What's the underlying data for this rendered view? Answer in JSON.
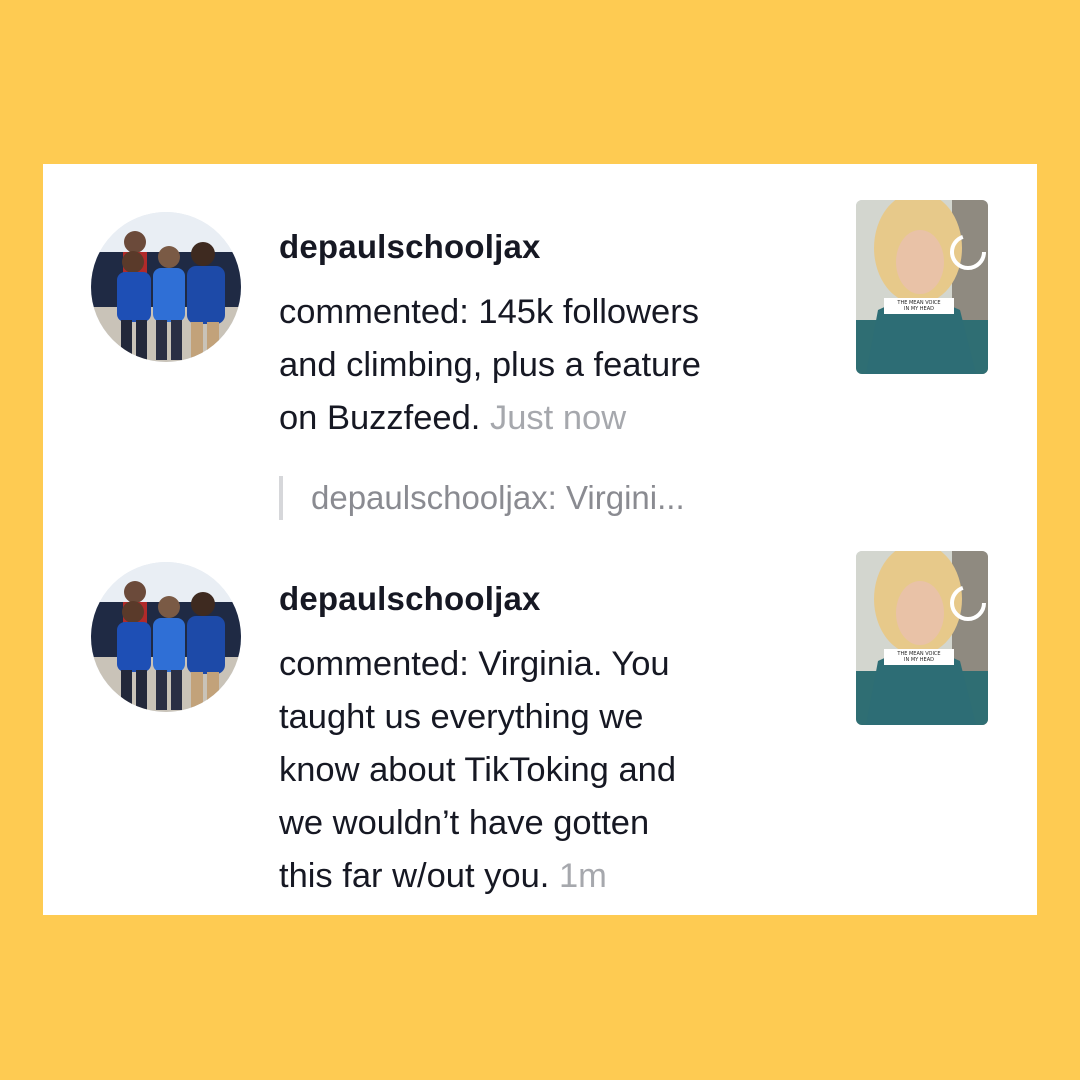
{
  "notifications": [
    {
      "username": "depaulschooljax",
      "avatar_icon": "group-photo-avatar",
      "comment_lines": [
        "commented: 145k followers",
        "and climbing, plus a feature",
        "on Buzzfeed."
      ],
      "time": "Just now",
      "reply_quote": "depaulschooljax: Virgini...",
      "thumbnail": {
        "icon": "video-thumbnail",
        "caption_line1": "THE MEAN VOICE",
        "caption_line2": "IN MY HEAD"
      }
    },
    {
      "username": "depaulschooljax",
      "avatar_icon": "group-photo-avatar",
      "comment_lines": [
        "commented: Virginia. You",
        "taught us everything we",
        "know about TikToking and",
        "we wouldn’t have gotten",
        "this far w/out you."
      ],
      "time": "1m",
      "thumbnail": {
        "icon": "video-thumbnail",
        "caption_line1": "THE MEAN VOICE",
        "caption_line2": "IN MY HEAD"
      }
    }
  ],
  "colors": {
    "background": "#FECB52",
    "card": "#FFFFFF",
    "text_primary": "#161823",
    "text_time": "#A6A8AD",
    "text_quote": "#8A8B91"
  }
}
